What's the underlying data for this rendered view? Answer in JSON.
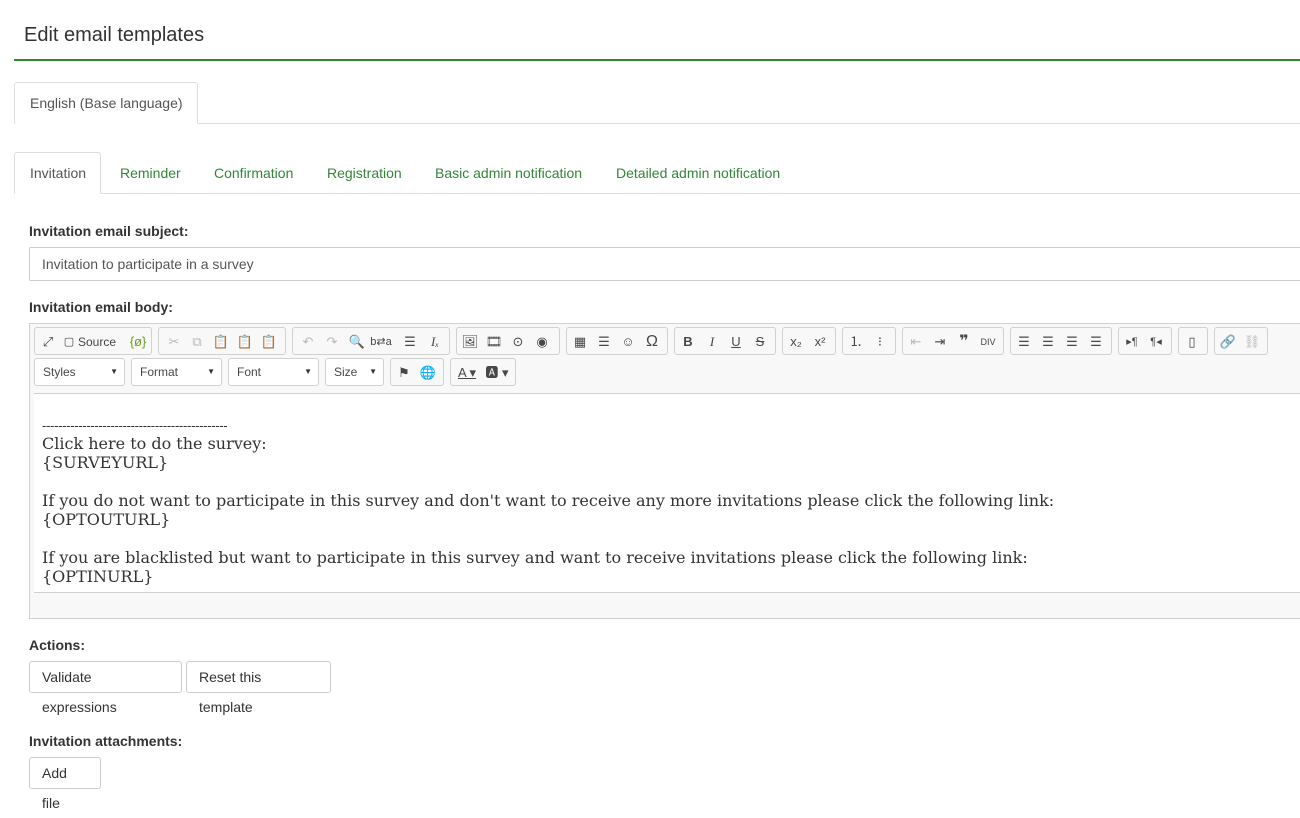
{
  "page": {
    "title": "Edit email templates"
  },
  "language_tabs": [
    {
      "label": "English (Base language)"
    }
  ],
  "template_tabs": [
    {
      "label": "Invitation"
    },
    {
      "label": "Reminder"
    },
    {
      "label": "Confirmation"
    },
    {
      "label": "Registration"
    },
    {
      "label": "Basic admin notification"
    },
    {
      "label": "Detailed admin notification"
    }
  ],
  "subject": {
    "label": "Invitation email subject:",
    "value": "Invitation to participate in a survey"
  },
  "body": {
    "label": "Invitation email body:",
    "toolbar": {
      "source_label": "Source",
      "styles_label": "Styles",
      "format_label": "Format",
      "font_label": "Font",
      "size_label": "Size"
    },
    "content": {
      "separator": "----------------------------------------------",
      "line1": "Click here to do the survey:",
      "line2": "{SURVEYURL}",
      "line3": "If you do not want to participate in this survey and don't want to receive any more invitations please click the following link:",
      "line4": "{OPTOUTURL}",
      "line5": "If you are blacklisted but want to participate in this survey and want to receive invitations please click the following link:",
      "line6": "{OPTINURL}"
    }
  },
  "actions": {
    "label": "Actions:",
    "validate_label": "Validate expressions",
    "reset_label": "Reset this template"
  },
  "attachments": {
    "label": "Invitation attachments:",
    "add_label": "Add file"
  },
  "colors": {
    "accent": "#328637",
    "border": "#dddddd"
  }
}
